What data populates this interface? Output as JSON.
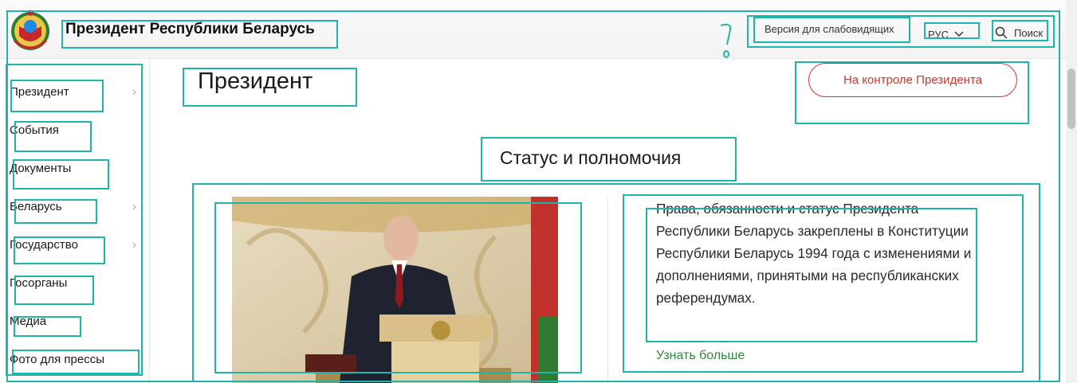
{
  "header": {
    "site_title": "Президент Республики Беларусь",
    "low_vision_label": "Версия для слабовидящих",
    "language": "РУС",
    "search_label": "Поиск"
  },
  "sidebar": {
    "items": [
      {
        "label": "Президент",
        "has_submenu": true
      },
      {
        "label": "События",
        "has_submenu": false
      },
      {
        "label": "Документы",
        "has_submenu": false
      },
      {
        "label": "Беларусь",
        "has_submenu": true
      },
      {
        "label": "Государство",
        "has_submenu": true
      },
      {
        "label": "Госорганы",
        "has_submenu": false
      },
      {
        "label": "Медиа",
        "has_submenu": false
      },
      {
        "label": "Фото для прессы",
        "has_submenu": false
      }
    ]
  },
  "main": {
    "page_title": "Президент",
    "control_button": "На контроле Президента",
    "section_title": "Статус и полномочия",
    "description": "Права, обязанности и статус Президента Республики Беларусь закреплены в Конституции Республики Беларусь 1994 года с изменениями и дополнениями, принятыми на республиканских референдумах.",
    "more_link": "Узнать больше"
  },
  "colors": {
    "accent_red": "#c7372f",
    "link_green": "#2f8a3a",
    "annotation_teal": "#1fb5ac"
  }
}
